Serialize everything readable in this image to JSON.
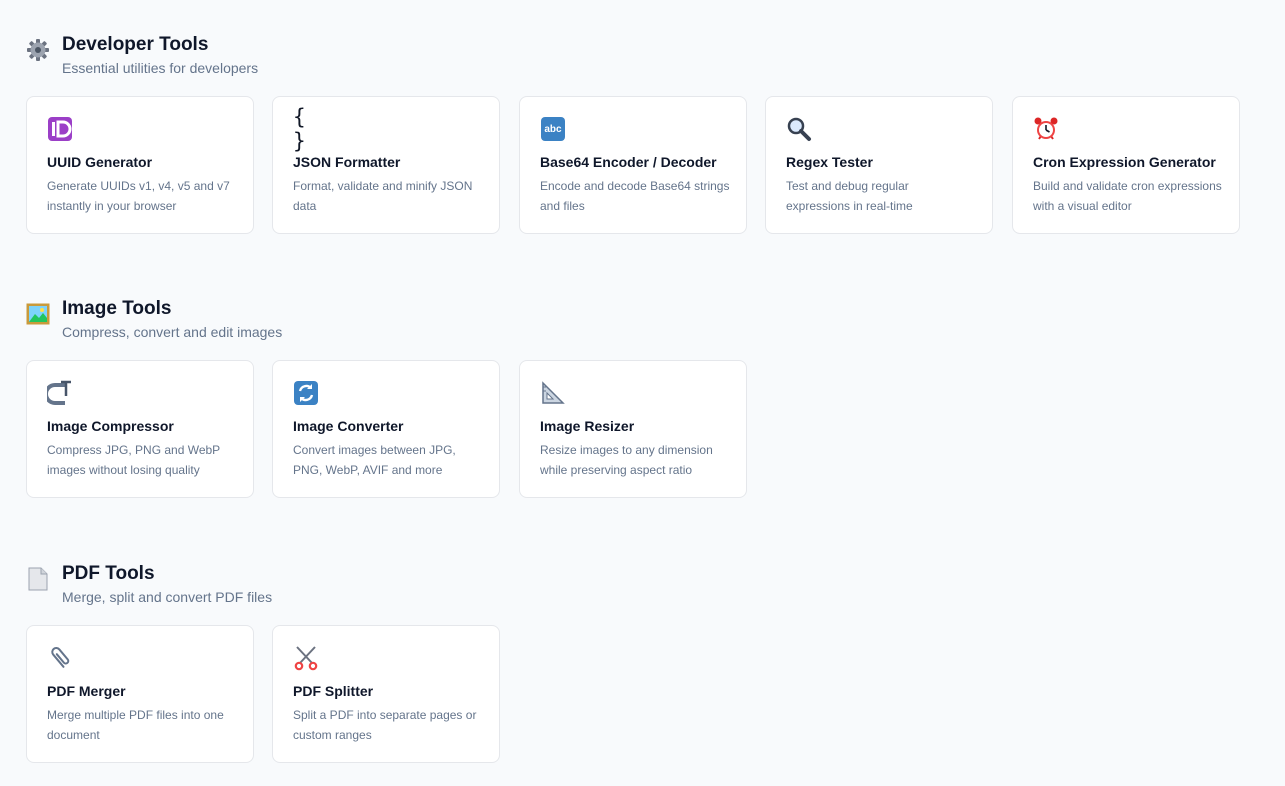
{
  "sections": [
    {
      "icon": "gear-icon",
      "title": "Developer Tools",
      "subtitle": "Essential utilities for developers",
      "tools": [
        {
          "icon": "id-badge-icon",
          "title": "UUID Generator",
          "description": "Generate UUIDs v1, v4, v5 and v7 instantly in your browser"
        },
        {
          "icon": "braces-icon",
          "title": "JSON Formatter",
          "description": "Format, validate and minify JSON data"
        },
        {
          "icon": "abc-badge-icon",
          "title": "Base64 Encoder / Decoder",
          "description": "Encode and decode Base64 strings and files"
        },
        {
          "icon": "magnifier-icon",
          "title": "Regex Tester",
          "description": "Test and debug regular expressions in real-time"
        },
        {
          "icon": "alarm-clock-icon",
          "title": "Cron Expression Generator",
          "description": "Build and validate cron expressions with a visual editor"
        }
      ]
    },
    {
      "icon": "framed-picture-icon",
      "title": "Image Tools",
      "subtitle": "Compress, convert and edit images",
      "tools": [
        {
          "icon": "clamp-icon",
          "title": "Image Compressor",
          "description": "Compress JPG, PNG and WebP images without losing quality"
        },
        {
          "icon": "refresh-arrows-icon",
          "title": "Image Converter",
          "description": "Convert images between JPG, PNG, WebP, AVIF and more"
        },
        {
          "icon": "triangular-ruler-icon",
          "title": "Image Resizer",
          "description": "Resize images to any dimension while preserving aspect ratio"
        }
      ]
    },
    {
      "icon": "document-page-icon",
      "title": "PDF Tools",
      "subtitle": "Merge, split and convert PDF files",
      "tools": [
        {
          "icon": "paperclip-icon",
          "title": "PDF Merger",
          "description": "Merge multiple PDF files into one document"
        },
        {
          "icon": "scissors-icon",
          "title": "PDF Splitter",
          "description": "Split a PDF into separate pages or custom ranges"
        }
      ]
    }
  ],
  "icon_texts": {
    "braces": "{ }",
    "abc": "abc"
  }
}
